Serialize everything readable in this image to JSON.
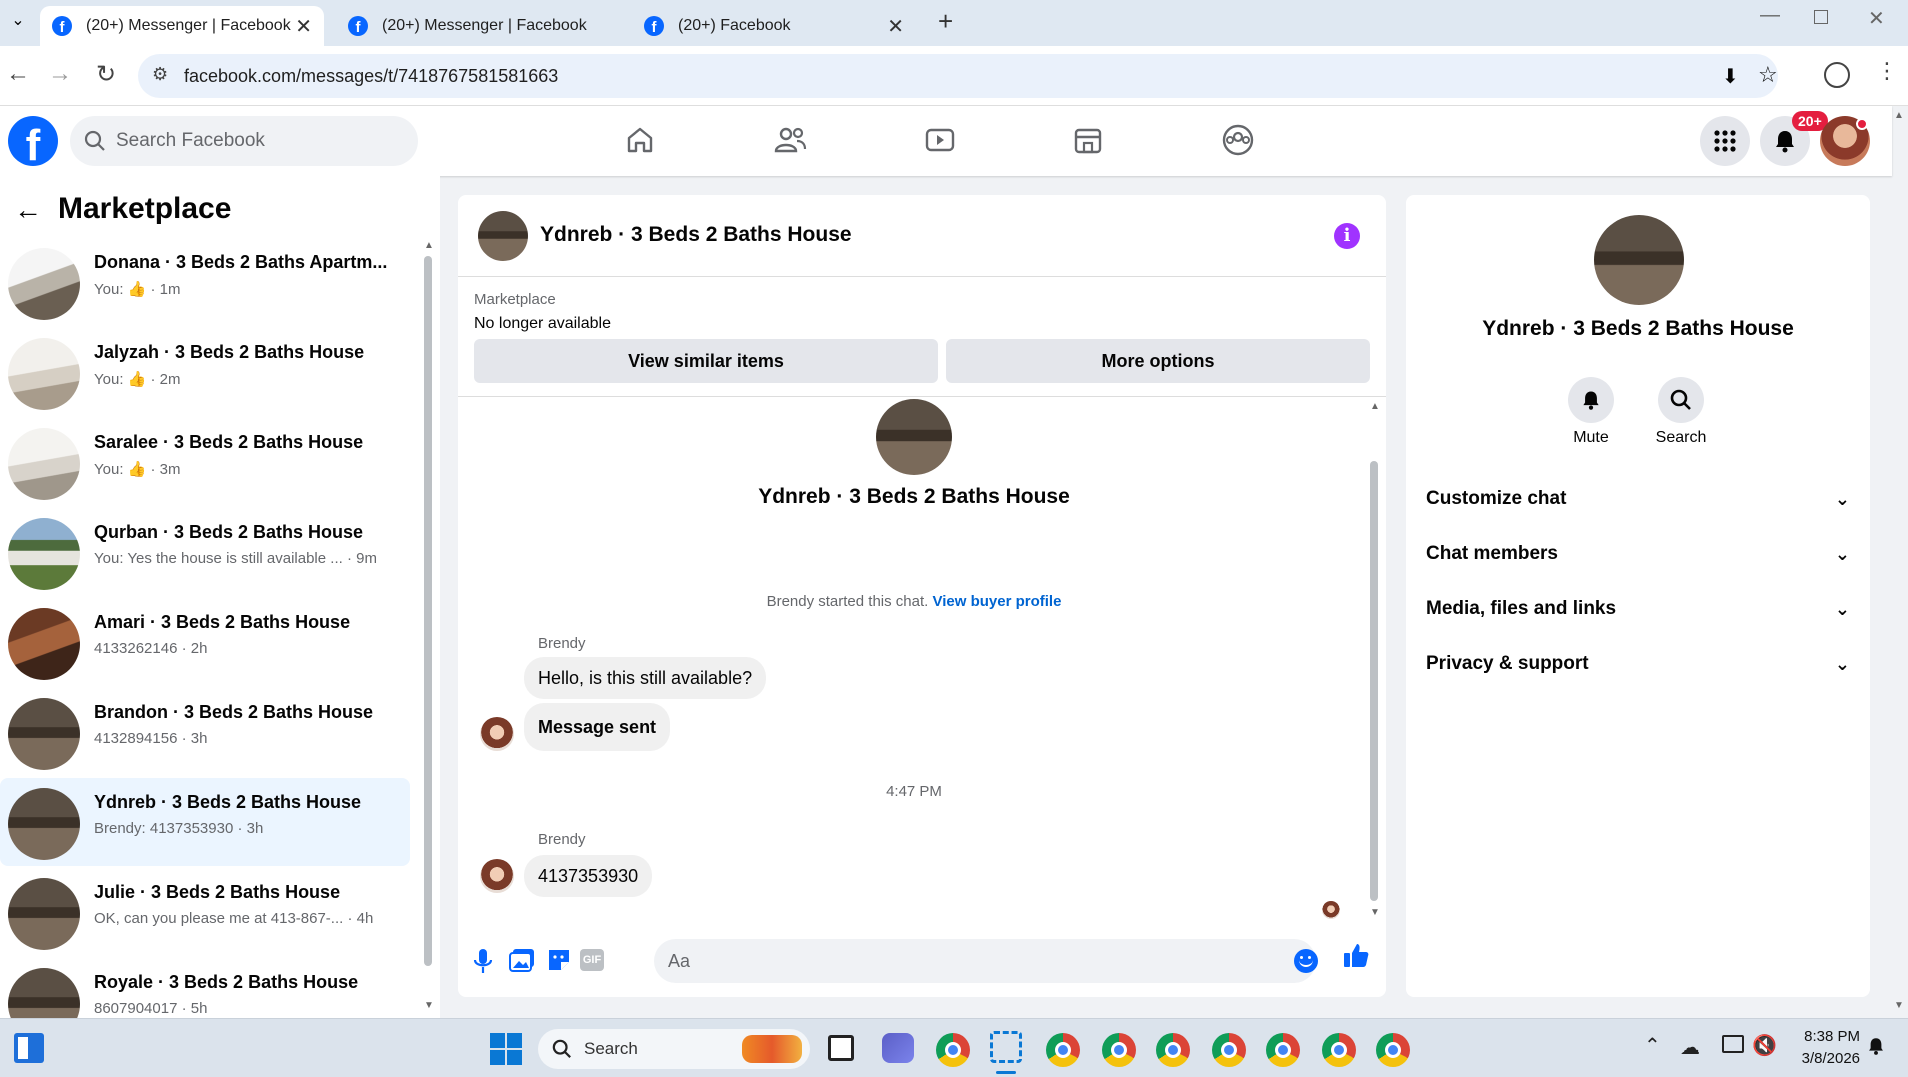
{
  "browser": {
    "tabs": [
      {
        "title": "(20+) Messenger | Facebook",
        "active": true
      },
      {
        "title": "(20+) Messenger | Facebook",
        "active": false
      },
      {
        "title": "(20+) Facebook",
        "active": false
      }
    ],
    "url": "facebook.com/messages/t/7418767581581663"
  },
  "fb_header": {
    "search_placeholder": "Search Facebook",
    "notification_badge": "20+"
  },
  "left_panel": {
    "title": "Marketplace",
    "conversations": [
      {
        "name": "Donana · 3 Beds 2 Baths Apartm...",
        "snippet": "You: 👍 · 1m",
        "selected": false
      },
      {
        "name": "Jalyzah · 3 Beds 2 Baths House",
        "snippet": "You: 👍 · 2m",
        "selected": false
      },
      {
        "name": "Saralee · 3 Beds 2 Baths House",
        "snippet": "You: 👍 · 3m",
        "selected": false
      },
      {
        "name": "Qurban · 3 Beds 2 Baths House",
        "snippet": "You: Yes the house is still available ... · 9m",
        "selected": false
      },
      {
        "name": "Amari · 3 Beds 2 Baths House",
        "snippet": "4133262146 · 2h",
        "selected": false
      },
      {
        "name": "Brandon · 3 Beds 2 Baths House",
        "snippet": "4132894156 · 3h",
        "selected": false
      },
      {
        "name": "Ydnreb · 3 Beds 2 Baths House",
        "snippet": "Brendy: 4137353930 · 3h",
        "selected": true
      },
      {
        "name": "Julie · 3 Beds 2 Baths House",
        "snippet": "OK, can you please me at 413-867-... · 4h",
        "selected": false
      },
      {
        "name": "Royale · 3 Beds 2 Baths House",
        "snippet": "8607904017 · 5h",
        "selected": false
      }
    ]
  },
  "chat": {
    "title": "Ydnreb · 3 Beds 2 Baths House",
    "marketplace_label": "Marketplace",
    "availability": "No longer available",
    "view_similar": "View similar items",
    "more_options": "More options",
    "intro_title": "Ydnreb · 3 Beds 2 Baths House",
    "started_text": "Brendy started this chat.",
    "view_buyer_profile": "View buyer profile",
    "sender1": "Brendy",
    "msg1": "Hello, is this still available?",
    "msg2": "Message sent",
    "timestamp": "4:47 PM",
    "sender2": "Brendy",
    "msg3": "4137353930",
    "composer_placeholder": "Aa"
  },
  "right_panel": {
    "title": "Ydnreb · 3 Beds 2 Baths House",
    "mute_label": "Mute",
    "search_label": "Search",
    "sections": [
      "Customize chat",
      "Chat members",
      "Media, files and links",
      "Privacy & support"
    ]
  },
  "taskbar": {
    "search_label": "Search",
    "time": "8:38 PM",
    "date": "3/8/2026"
  },
  "colors": {
    "fb_blue": "#0866ff",
    "selected_bg": "#ebf5ff",
    "info_purple": "#a033ff"
  }
}
